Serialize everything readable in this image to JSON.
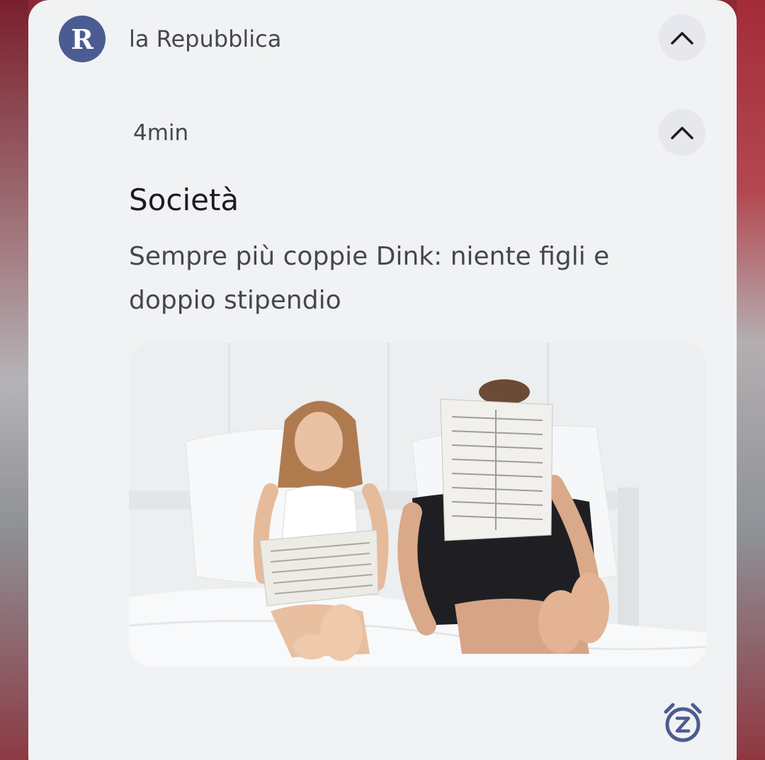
{
  "notification": {
    "app_icon_letter": "R",
    "app_name": "la Repubblica",
    "time": "4min",
    "title": "Società",
    "body": "Sempre più coppie Dink: niente figli e doppio stipendio"
  },
  "colors": {
    "app_icon_bg": "#4a5c92",
    "card_bg": "#f1f2f3",
    "snooze_icon": "#4a5c92"
  },
  "icons": {
    "collapse_group": "chevron-up-icon",
    "collapse_item": "chevron-up-icon",
    "snooze": "snooze-alarm-icon"
  }
}
